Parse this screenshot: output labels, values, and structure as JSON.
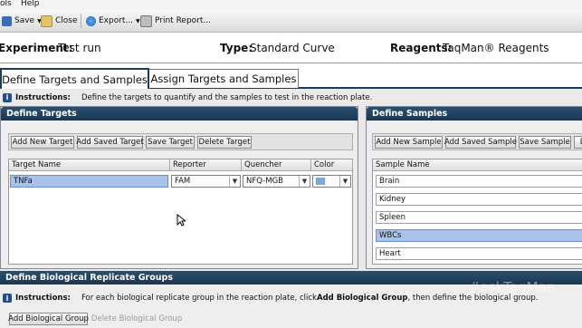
{
  "menu": {
    "items": [
      "ols",
      "Help"
    ]
  },
  "toolbar": {
    "save_label": "Save",
    "close_label": "Close",
    "export_label": "Export...",
    "print_label": "Print Report..."
  },
  "experiment": {
    "experiment_label": "Experiment:",
    "experiment_value": "Test run",
    "type_label": "Type:",
    "type_value": "Standard Curve",
    "reagents_label": "Reagents:",
    "reagents_value": "TaqMan® Reagents"
  },
  "tabs": [
    {
      "label": "Define Targets and Samples",
      "active": true
    },
    {
      "label": "Assign Targets and Samples",
      "active": false
    }
  ],
  "instructions": {
    "label": "Instructions:",
    "text": "Define the targets to quantify and the samples to test in the reaction plate."
  },
  "define_targets": {
    "title": "Define Targets",
    "buttons": [
      "Add New Target",
      "Add Saved Target",
      "Save Target",
      "Delete Target"
    ],
    "columns": [
      "Target Name",
      "Reporter",
      "Quencher",
      "Color"
    ],
    "rows": [
      {
        "name": "TNFa",
        "reporter": "FAM",
        "quencher": "NFQ-MGB",
        "color": "#7da7e0"
      }
    ]
  },
  "define_samples": {
    "title": "Define Samples",
    "buttons": [
      "Add New Sample",
      "Add Saved Sample",
      "Save Sample",
      "D"
    ],
    "column": "Sample Name",
    "rows": [
      "Brain",
      "Kidney",
      "Spleen",
      "WBCs",
      "Heart"
    ],
    "selected_index": 3
  },
  "bio_groups": {
    "title": "Define Biological Replicate Groups",
    "instructions_label": "Instructions:",
    "instructions_prefix": "For each biological replicate group in the reaction plate, click ",
    "instructions_bold": "Add Biological Group",
    "instructions_suffix": ", then define the biological group.",
    "buttons": [
      "Add Biological Group",
      "Delete Biological Group"
    ]
  },
  "watermark": "#askTaqMan",
  "colors": {
    "panel_header": "#1f3f5e",
    "selection": "#a9c2ea",
    "accent": "#1f4e8c"
  }
}
